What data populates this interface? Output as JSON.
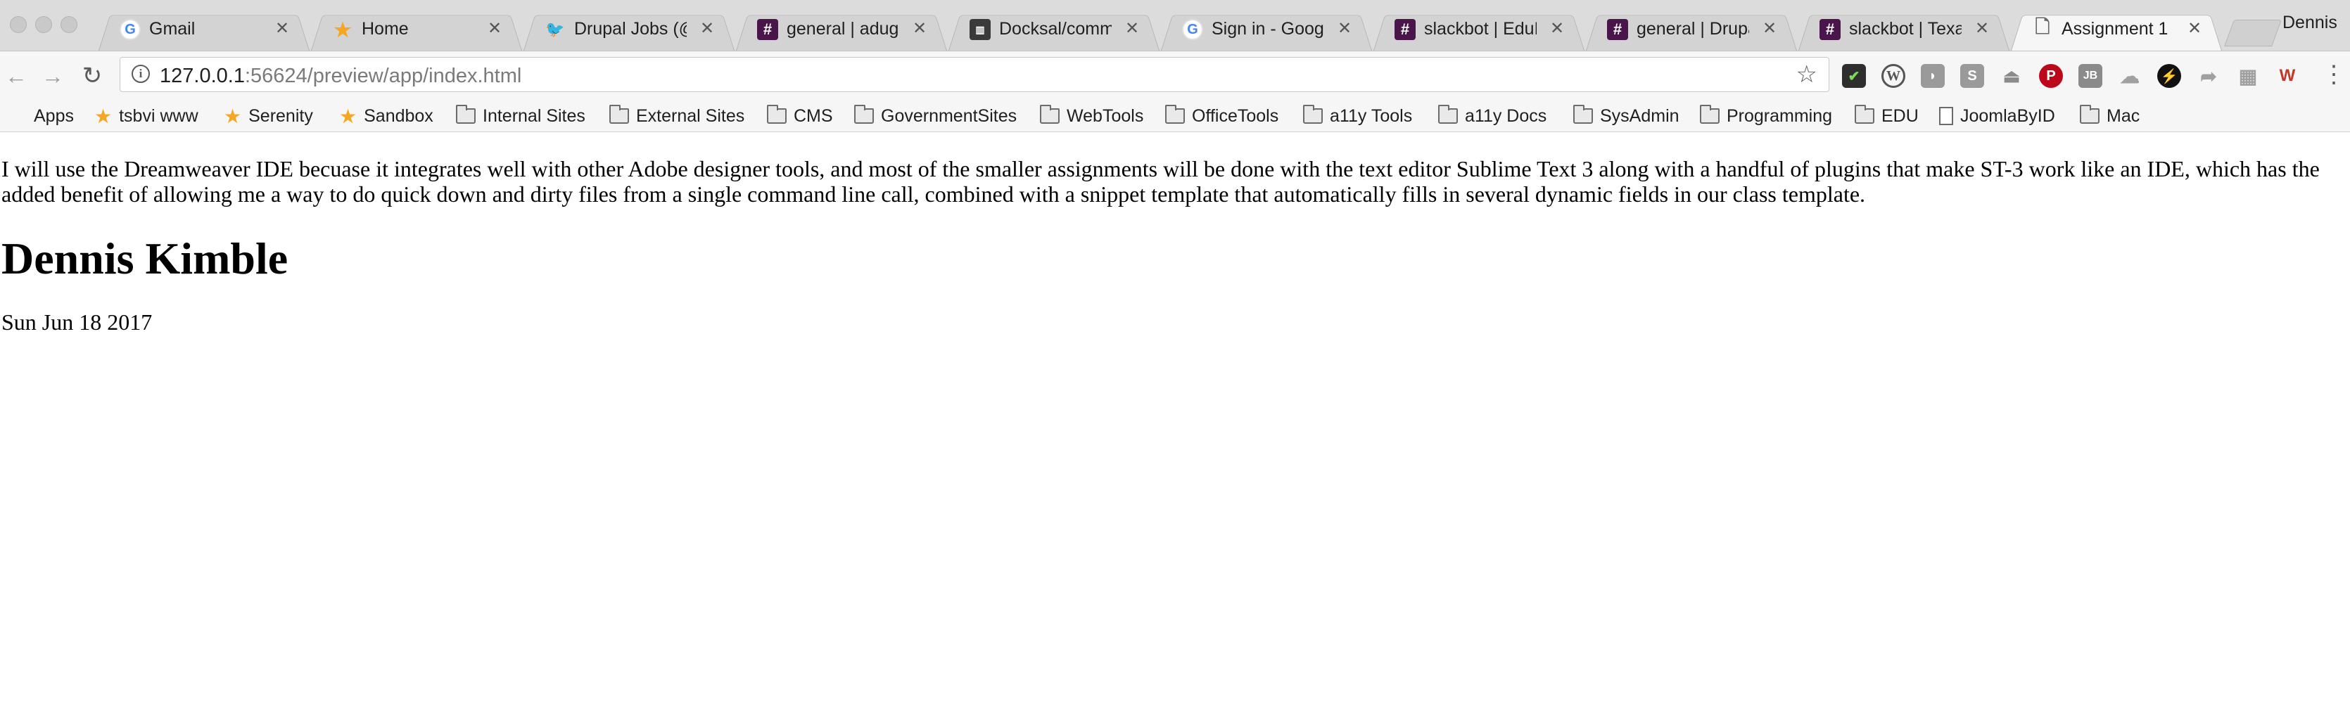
{
  "browser": {
    "tabs": [
      {
        "title": "Gmail",
        "favicon": "google-icon",
        "active": false
      },
      {
        "title": "Home",
        "favicon": "star-icon",
        "active": false
      },
      {
        "title": "Drupal Jobs (@d",
        "favicon": "twitter-icon",
        "active": false
      },
      {
        "title": "general | adug Sl",
        "favicon": "slack-icon",
        "active": false
      },
      {
        "title": "Docksal/commun",
        "favicon": "docksal-icon",
        "active": false
      },
      {
        "title": "Sign in - Google",
        "favicon": "google-icon",
        "active": false
      },
      {
        "title": "slackbot | EduDU",
        "favicon": "slack-icon",
        "active": false
      },
      {
        "title": "general | Drupal",
        "favicon": "slack-icon",
        "active": false
      },
      {
        "title": "slackbot | Texas",
        "favicon": "slack-icon",
        "active": false
      },
      {
        "title": "Assignment 1",
        "favicon": "document-icon",
        "active": true
      }
    ],
    "profile_name": "Dennis",
    "address": {
      "host": "127.0.0.1",
      "rest": ":56624/preview/app/index.html"
    },
    "bookmarks": [
      {
        "label": "Apps",
        "icon": "apps-grid-icon"
      },
      {
        "label": "tsbvi www",
        "icon": "star-icon"
      },
      {
        "label": "Serenity",
        "icon": "star-icon"
      },
      {
        "label": "Sandbox",
        "icon": "star-icon"
      },
      {
        "label": "Internal Sites",
        "icon": "folder-icon"
      },
      {
        "label": "External Sites",
        "icon": "folder-icon"
      },
      {
        "label": "CMS",
        "icon": "folder-icon"
      },
      {
        "label": "GovernmentSites",
        "icon": "folder-icon"
      },
      {
        "label": "WebTools",
        "icon": "folder-icon"
      },
      {
        "label": "OfficeTools",
        "icon": "folder-icon"
      },
      {
        "label": "a11y Tools",
        "icon": "folder-icon"
      },
      {
        "label": "a11y Docs",
        "icon": "folder-icon"
      },
      {
        "label": "SysAdmin",
        "icon": "folder-icon"
      },
      {
        "label": "Programming",
        "icon": "folder-icon"
      },
      {
        "label": "EDU",
        "icon": "folder-icon"
      },
      {
        "label": "JoomlaByID",
        "icon": "page-icon"
      },
      {
        "label": "Mac",
        "icon": "folder-icon"
      }
    ],
    "extensions": [
      "checklist-icon",
      "wordpress-icon",
      "pocket-icon",
      "scribe-icon",
      "eject-icon",
      "pinterest-icon",
      "jb-icon",
      "refresh-cloud-icon",
      "compass-icon",
      "share-icon",
      "grid-icon",
      "wappalyzer-icon"
    ]
  },
  "page": {
    "intro": "I will use the Dreamweaver IDE becuase it integrates well with other Adobe designer tools, and most of the smaller assignments will be done with the text editor Sublime Text 3 along with a handful of plugins that make ST-3 work like an IDE, which has the added benefit of allowing me a way to do quick down and dirty files from a single command line call, combined with a snippet template that automatically fills in several dynamic fields in our class template.",
    "heading": "Dennis Kimble",
    "date": "Sun Jun 18 2017"
  },
  "colors": {
    "google_blue": "#4285f4",
    "star": "#f5a623",
    "twitter": "#1da1f2",
    "slack": "#4a154b",
    "pinterest": "#bd081c"
  }
}
